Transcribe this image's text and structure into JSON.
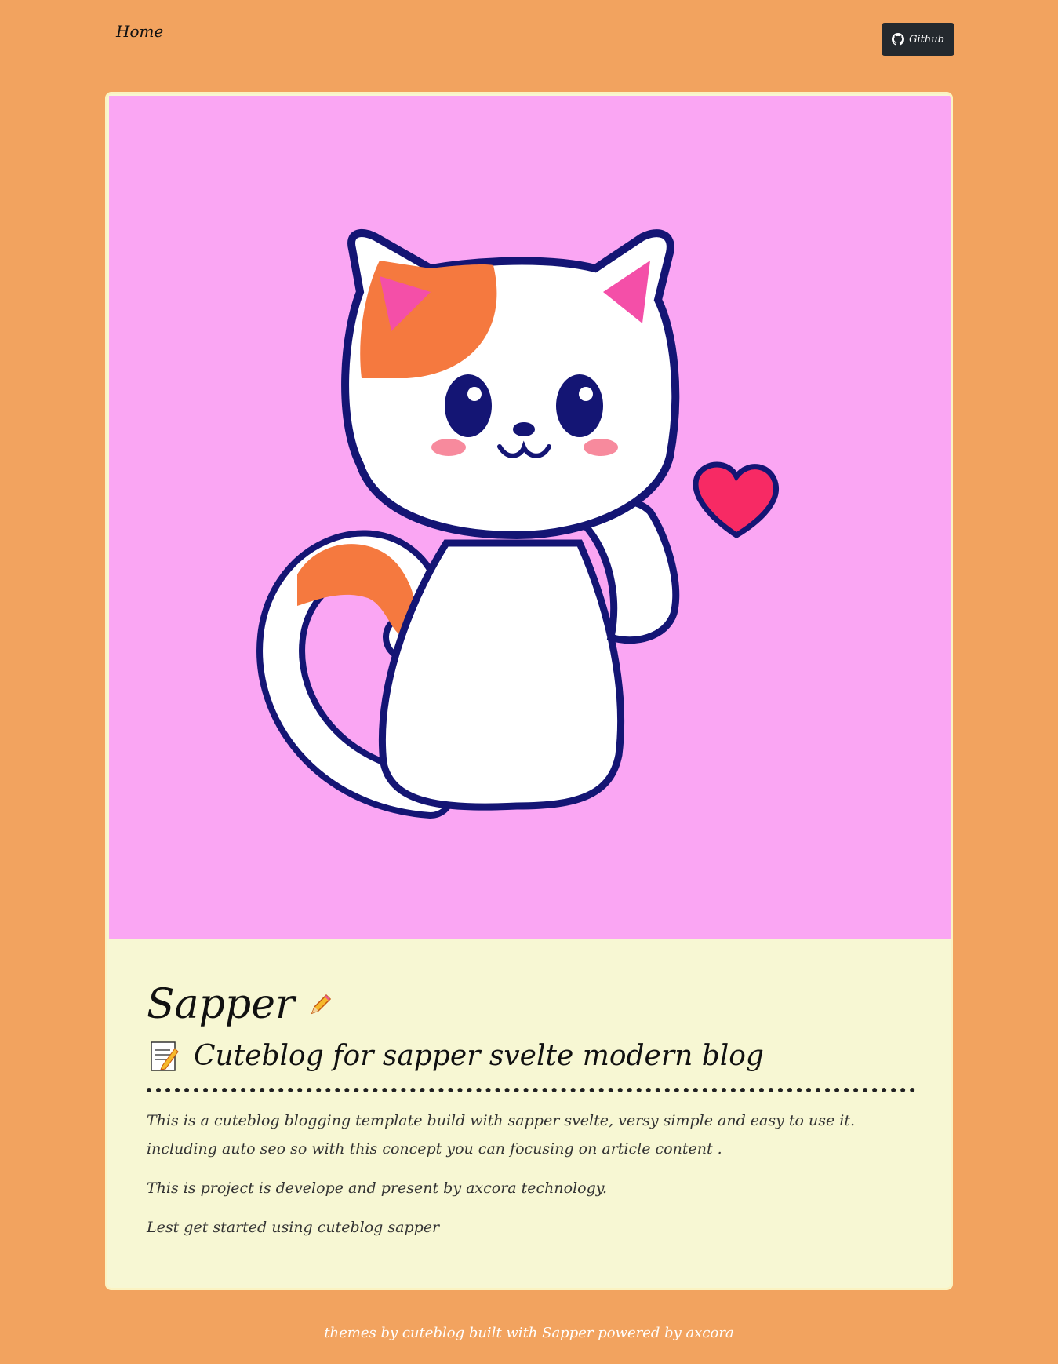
{
  "nav": {
    "home_label": "Home",
    "github_label": "Github"
  },
  "post": {
    "title": "Sapper",
    "title_icon": "pencil-icon",
    "subtitle": "Cuteblog for sapper svelte modern blog",
    "subtitle_icon": "memo-icon",
    "paragraph_1": "This is a cuteblog blogging template build with sapper svelte, versy simple and easy to use it. including auto seo so with this concept you can focusing on article content .",
    "paragraph_2": "This is project is develope and present by axcora technology.",
    "paragraph_3": "Lest get started using cuteblog sapper",
    "hero_image": "cute-cat-illustration"
  },
  "footer": {
    "text": "themes by cuteblog built with Sapper powered by axcora"
  },
  "colors": {
    "page_background": "#f2a35f",
    "card_background": "#f7f7d3",
    "hero_background": "#faa6f3",
    "github_button": "#24292e"
  }
}
